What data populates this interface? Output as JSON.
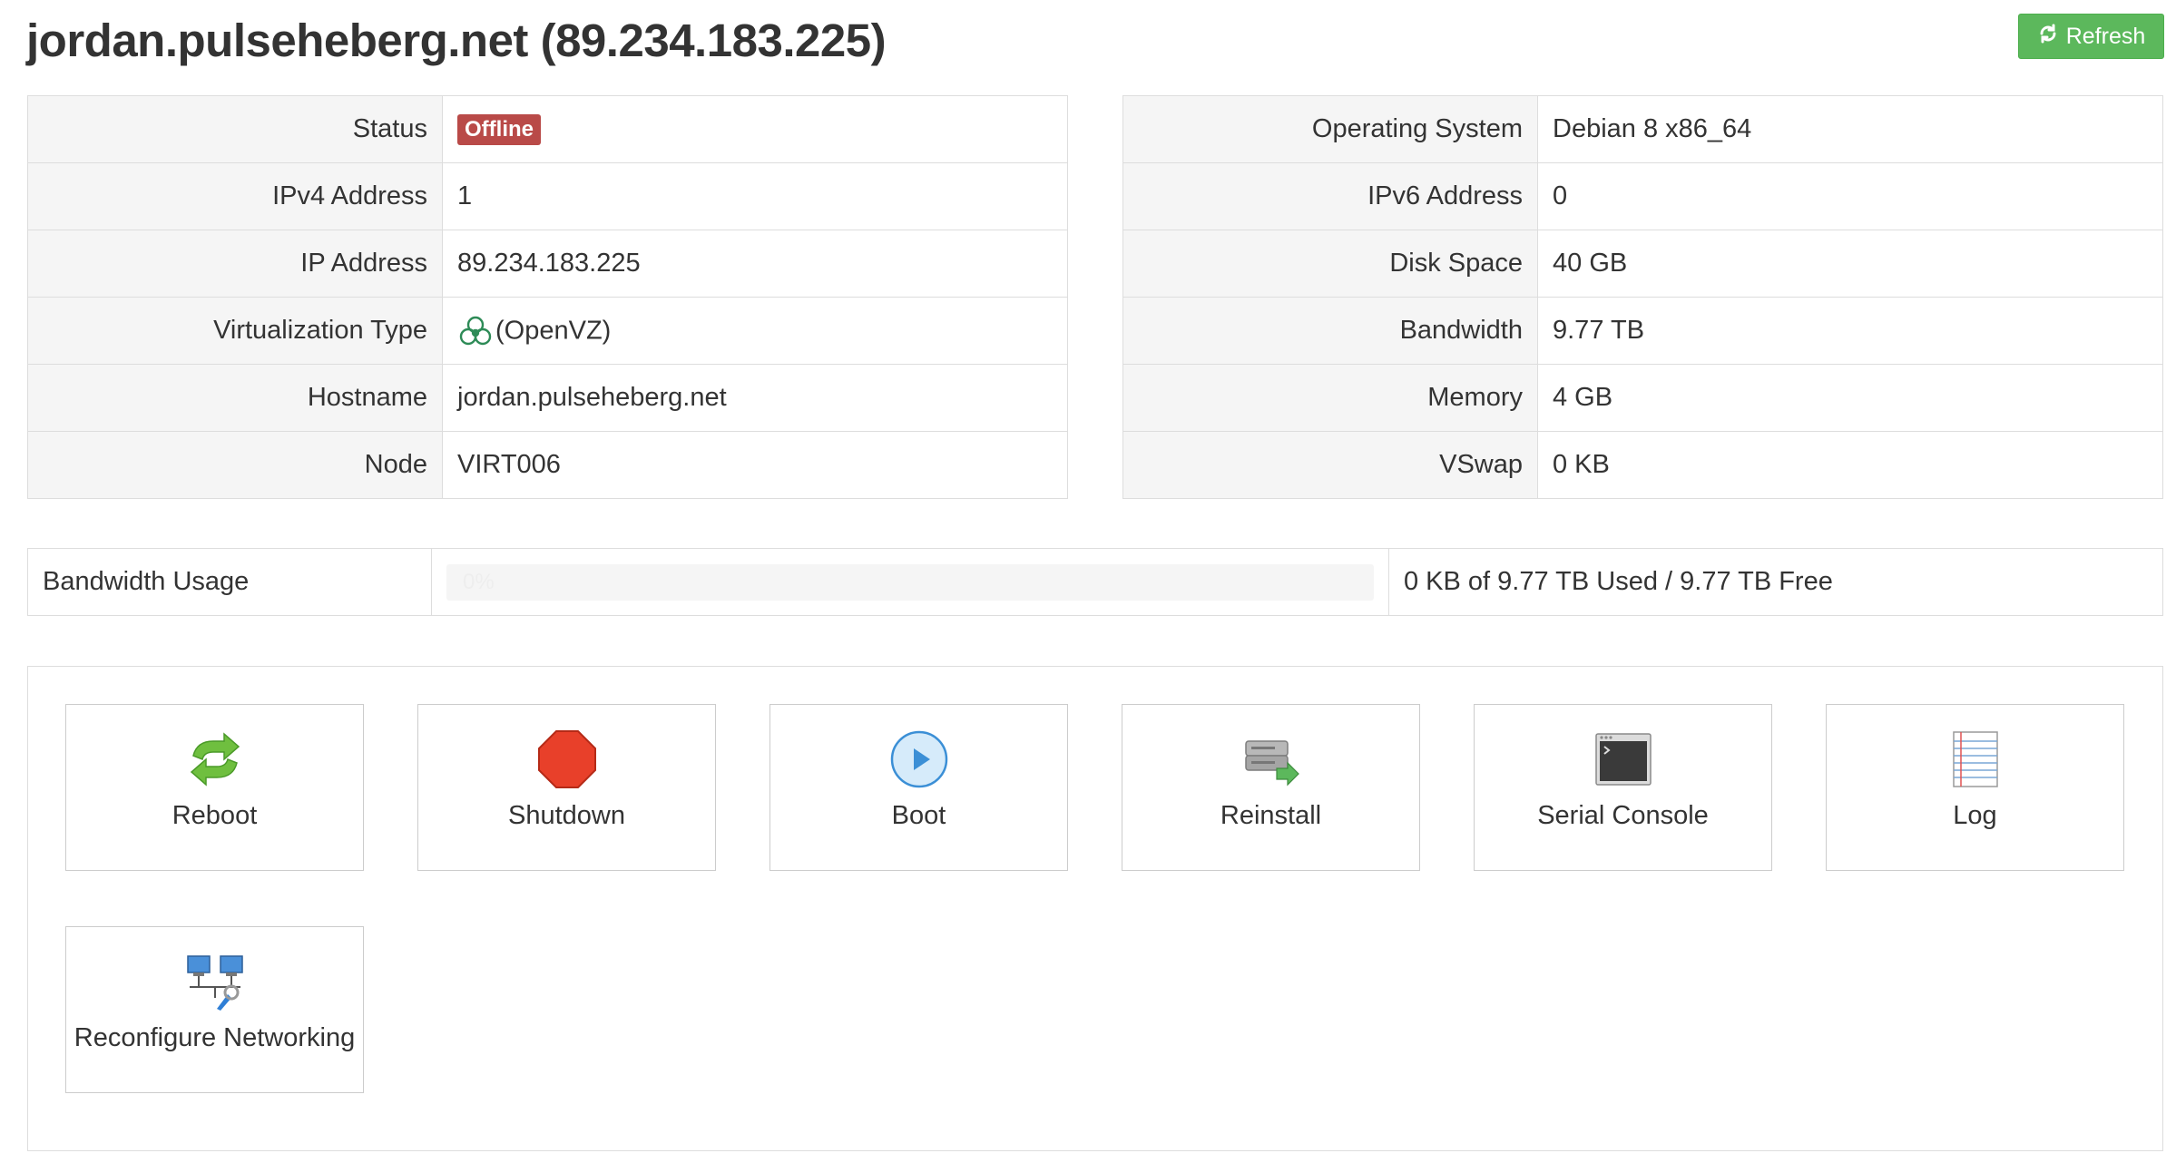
{
  "page": {
    "title": "jordan.pulseheberg.net (89.234.183.225)",
    "refresh_label": "Refresh",
    "refresh_icon": "refresh-icon",
    "colors": {
      "refresh": "#5cb85c",
      "offline_badge": "#b94a48",
      "label_bg": "#f5f5f5",
      "border": "#dddddd"
    }
  },
  "left_info": [
    {
      "label": "Status",
      "value": "Offline",
      "type": "badge"
    },
    {
      "label": "IPv4 Address",
      "value": "1"
    },
    {
      "label": "IP Address",
      "value": "89.234.183.225"
    },
    {
      "label": "Virtualization Type",
      "value": "(OpenVZ)",
      "icon": "openvz-icon"
    },
    {
      "label": "Hostname",
      "value": "jordan.pulseheberg.net"
    },
    {
      "label": "Node",
      "value": "VIRT006"
    }
  ],
  "right_info": [
    {
      "label": "Operating System",
      "value": "Debian 8 x86_64"
    },
    {
      "label": "IPv6 Address",
      "value": "0"
    },
    {
      "label": "Disk Space",
      "value": "40 GB"
    },
    {
      "label": "Bandwidth",
      "value": "9.77 TB"
    },
    {
      "label": "Memory",
      "value": "4 GB"
    },
    {
      "label": "VSwap",
      "value": "0 KB"
    }
  ],
  "bandwidth": {
    "label": "Bandwidth Usage",
    "percent": 0,
    "percent_text": "0%",
    "summary": "0 KB of 9.77 TB Used / 9.77 TB Free"
  },
  "actions": [
    {
      "label": "Reboot",
      "icon": "reboot-icon"
    },
    {
      "label": "Shutdown",
      "icon": "shutdown-icon"
    },
    {
      "label": "Boot",
      "icon": "boot-icon"
    },
    {
      "label": "Reinstall",
      "icon": "reinstall-icon"
    },
    {
      "label": "Serial Console",
      "icon": "serial-console-icon"
    },
    {
      "label": "Log",
      "icon": "log-icon"
    },
    {
      "label": "Reconfigure Networking",
      "icon": "network-icon"
    }
  ]
}
